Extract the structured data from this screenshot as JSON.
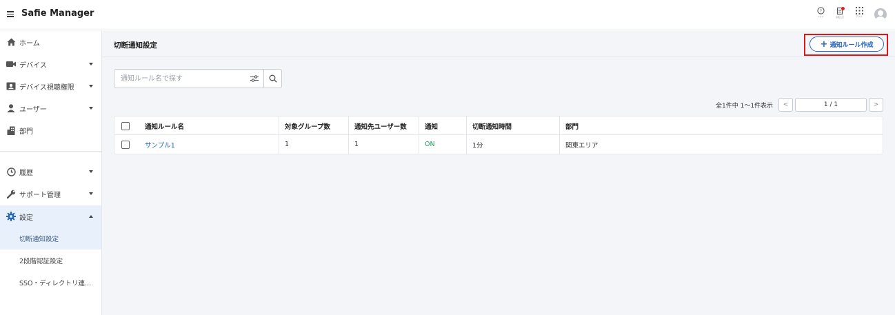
{
  "app": {
    "title": "Safie Manager"
  },
  "top_icons": [
    {
      "icon": "help-icon",
      "caption": "ヘルプ"
    },
    {
      "icon": "notification-icon",
      "caption": "お知らせ"
    },
    {
      "icon": "apps-icon",
      "caption": "アプリ"
    },
    {
      "icon": "avatar-icon",
      "caption": ""
    }
  ],
  "sidebar": {
    "items": [
      {
        "label": "ホーム",
        "icon": "home-icon"
      },
      {
        "label": "デバイス",
        "icon": "camera-icon"
      },
      {
        "label": "デバイス視聴権限",
        "icon": "id-card-icon"
      },
      {
        "label": "ユーザー",
        "icon": "user-icon"
      },
      {
        "label": "部門",
        "icon": "building-icon"
      },
      {
        "label": "履歴",
        "icon": "clock-icon"
      },
      {
        "label": "サポート管理",
        "icon": "wrench-icon"
      },
      {
        "label": "設定",
        "icon": "gear-icon"
      }
    ],
    "sub_items": [
      {
        "label": "切断通知設定"
      },
      {
        "label": "2段階認証設定"
      },
      {
        "label": "SSO・ディレクトリ連…"
      }
    ]
  },
  "page": {
    "title": "切断通知設定",
    "create_button": "通知ルール作成",
    "search_placeholder": "通知ルール名で探す"
  },
  "pager": {
    "count_text": "全1件中 1〜1件表示",
    "page_text": "1 / 1",
    "prev": "<",
    "next": ">"
  },
  "table": {
    "headers": [
      "通知ルール名",
      "対象グループ数",
      "通知先ユーザー数",
      "通知",
      "切断通知時間",
      "部門"
    ],
    "rows": [
      [
        "サンプル1",
        "1",
        "1",
        "ON",
        "1分",
        "関東エリア"
      ]
    ]
  },
  "colors": {
    "accent": "#2466c2",
    "highlight": "#e01515",
    "on_status": "#1e9e5a",
    "active_bg": "#e8f1fb"
  }
}
